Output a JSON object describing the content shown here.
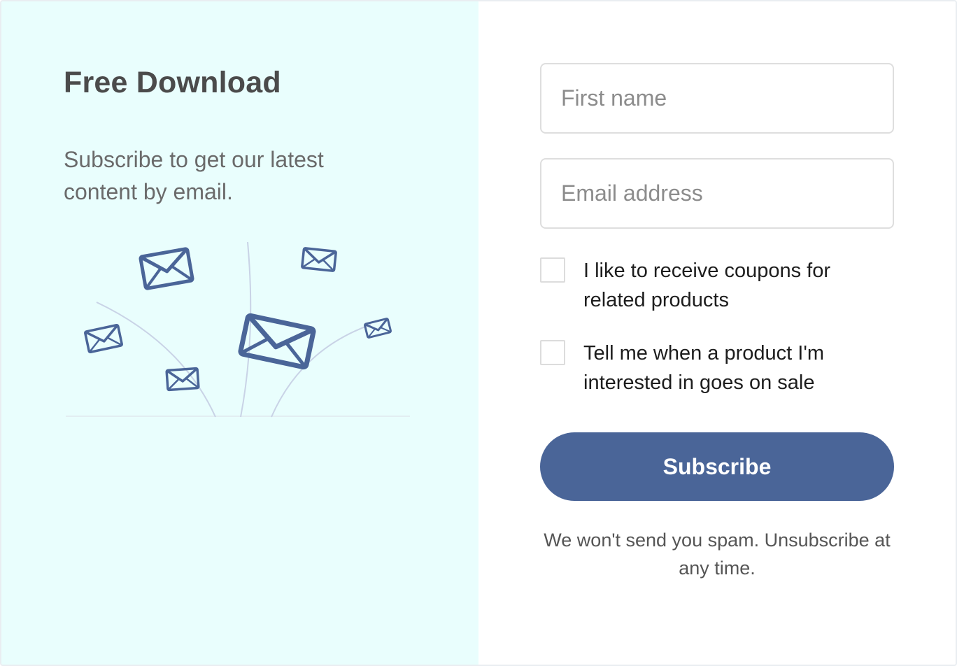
{
  "promo": {
    "title": "Free Download",
    "subtitle": "Subscribe to get our latest content by email.",
    "illustration_icon": "flying-envelopes-illustration"
  },
  "form": {
    "first_name_placeholder": "First name",
    "first_name_value": "",
    "email_placeholder": "Email address",
    "email_value": "",
    "options": [
      {
        "label": "I like to receive coupons for related products",
        "checked": false
      },
      {
        "label": "Tell me when a product I'm interested in goes on sale",
        "checked": false
      }
    ],
    "subscribe_label": "Subscribe",
    "footnote": "We won't send you spam. Unsubscribe at any time."
  },
  "colors": {
    "left_background": "#e9fefd",
    "accent": "#4a6598",
    "envelope": "#4a6598"
  }
}
